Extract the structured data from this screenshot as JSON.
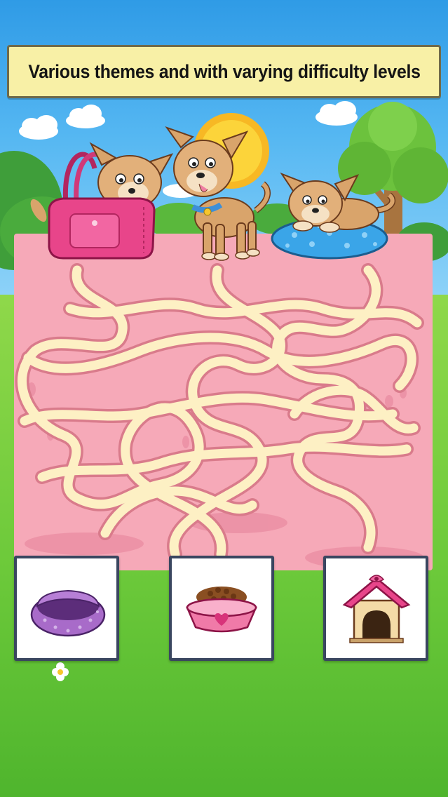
{
  "banner": {
    "text": "Various themes and with varying difficulty levels"
  },
  "characters": [
    {
      "name": "puppy-in-handbag-icon"
    },
    {
      "name": "standing-puppy-icon"
    },
    {
      "name": "puppy-on-cushion-icon"
    }
  ],
  "targets": [
    {
      "name": "dog-bed-icon",
      "label": "dog bed"
    },
    {
      "name": "dog-food-bowl-icon",
      "label": "food bowl"
    },
    {
      "name": "doghouse-icon",
      "label": "doghouse"
    }
  ],
  "colors": {
    "sky": "#4aaeee",
    "grass": "#6cc93a",
    "banner": "#f8f0a6",
    "maze_board": "#f6a9b8",
    "maze_path": "#fdf0c4",
    "maze_outline": "#d97b8b",
    "tile_border": "#3a4660"
  }
}
